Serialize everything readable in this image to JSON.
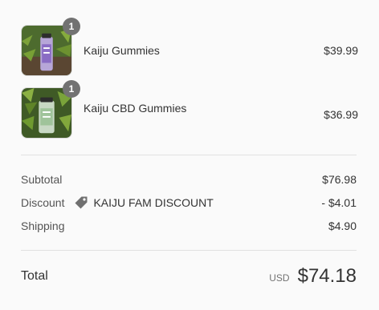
{
  "products": [
    {
      "name": "Kaiju Gummies",
      "price": "$39.99",
      "quantity": "1",
      "image_icon": "product-photo-bottle"
    },
    {
      "name": "Kaiju CBD Gummies",
      "price": "$36.99",
      "quantity": "1",
      "image_icon": "product-photo-bottle"
    }
  ],
  "summary": {
    "subtotal_label": "Subtotal",
    "subtotal_value": "$76.98",
    "discount_label": "Discount",
    "discount_code": "KAIJU FAM DISCOUNT",
    "discount_value": "- $4.01",
    "shipping_label": "Shipping",
    "shipping_value": "$4.90"
  },
  "total": {
    "label": "Total",
    "currency": "USD",
    "amount": "$74.18"
  },
  "colors": {
    "background": "#fafafa",
    "badge": "#727272",
    "text": "#333333",
    "muted": "#545454"
  }
}
